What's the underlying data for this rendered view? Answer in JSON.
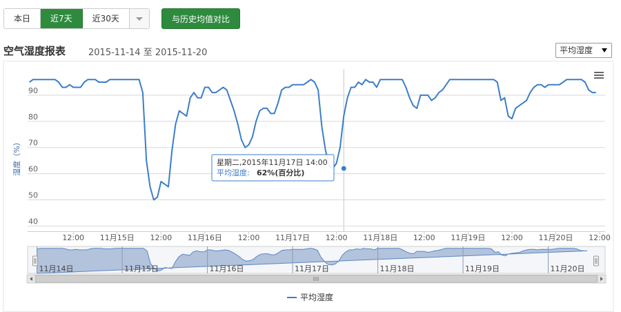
{
  "toolbar": {
    "range_buttons": [
      {
        "label": "本日",
        "active": false
      },
      {
        "label": "近7天",
        "active": true
      },
      {
        "label": "近30天",
        "active": false
      }
    ],
    "dropdown_icon": "caret-down-icon",
    "compare_label": "与历史均值对比"
  },
  "header": {
    "title": "空气湿度报表",
    "date_from": "2015-11-14",
    "date_sep": "至",
    "date_to": "2015-11-20",
    "metric_select": "平均湿度"
  },
  "colors": {
    "accent_green": "#2e8b3e",
    "series_line": "#3b7dc8",
    "navigator_fill": "#b3c3dc",
    "axis_title": "#3e6ea8"
  },
  "menu_icon": "hamburger-menu-icon",
  "tooltip": {
    "line1": "星期二,2015年11月17日 14:00",
    "label": "平均湿度:",
    "value": "62%(百分比)"
  },
  "chart_data": {
    "type": "line",
    "ylabel": "湿度（%）",
    "ylim": [
      38,
      100
    ],
    "y_ticks": [
      40,
      50,
      60,
      70,
      80,
      90
    ],
    "grid": true,
    "x_ticks": [
      "12:00",
      "11月15日",
      "12:00",
      "11月16日",
      "12:00",
      "11月17日",
      "12:00",
      "11月18日",
      "12:00",
      "11月19日",
      "12:00",
      "11月20日",
      "12:00"
    ],
    "x_tick_hours": [
      12,
      24,
      36,
      48,
      60,
      72,
      84,
      96,
      108,
      120,
      132,
      144,
      156
    ],
    "navigator_labels": [
      "11月14日",
      "11月15日",
      "11月16日",
      "11月17日",
      "11月18日",
      "11月19日",
      "11月20日"
    ],
    "navigator_hours": [
      0,
      24,
      48,
      72,
      96,
      120,
      144
    ],
    "legend": "top-center",
    "series": [
      {
        "name": "平均湿度",
        "x_hours": [
          0,
          1,
          2,
          3,
          4,
          5,
          6,
          7,
          8,
          9,
          10,
          11,
          12,
          13,
          14,
          15,
          16,
          17,
          18,
          19,
          20,
          21,
          22,
          23,
          24,
          25,
          26,
          27,
          28,
          29,
          30,
          31,
          32,
          33,
          34,
          35,
          36,
          37,
          38,
          39,
          40,
          41,
          42,
          43,
          44,
          45,
          46,
          47,
          48,
          49,
          50,
          51,
          52,
          53,
          54,
          55,
          56,
          57,
          58,
          59,
          60,
          61,
          62,
          63,
          64,
          65,
          66,
          67,
          68,
          69,
          70,
          71,
          72,
          73,
          74,
          75,
          76,
          77,
          78,
          79,
          80,
          81,
          82,
          83,
          84,
          85,
          86,
          87,
          88,
          89,
          90,
          91,
          92,
          93,
          94,
          95,
          96,
          97,
          98,
          99,
          100,
          101,
          102,
          103,
          104,
          105,
          106,
          107,
          108,
          109,
          110,
          111,
          112,
          113,
          114,
          115,
          116,
          117,
          118,
          119,
          120,
          121,
          122,
          123,
          124,
          125,
          126,
          127,
          128,
          129,
          130,
          131,
          132,
          133,
          134,
          135,
          136,
          137,
          138,
          139,
          140,
          141,
          142,
          143,
          144,
          145,
          146,
          147,
          148,
          149,
          150,
          151,
          152,
          153,
          154,
          155,
          156,
          157
        ],
        "values": [
          95,
          96,
          96,
          96,
          96,
          96,
          96,
          96,
          95,
          93,
          93,
          94,
          93,
          93,
          93,
          95,
          96,
          96,
          96,
          95,
          95,
          95,
          96,
          96,
          96,
          96,
          96,
          96,
          96,
          96,
          96,
          91,
          65,
          55,
          50,
          51,
          57,
          56,
          55,
          69,
          79,
          84,
          83,
          82,
          89,
          91,
          89,
          89,
          93,
          93,
          91,
          91,
          92,
          93,
          92,
          88,
          84,
          79,
          73,
          70,
          71,
          74,
          80,
          84,
          85,
          85,
          83,
          83,
          87,
          92,
          93,
          93,
          94,
          94,
          94,
          94,
          95,
          96,
          95,
          92,
          78,
          69,
          63,
          62,
          64,
          70,
          82,
          89,
          93,
          93,
          95,
          94,
          96,
          95,
          95,
          93,
          96,
          96,
          96,
          96,
          96,
          96,
          96,
          93,
          89,
          86,
          85,
          90,
          90,
          90,
          88,
          89,
          91,
          92,
          94,
          96,
          96,
          96,
          96,
          96,
          96,
          96,
          96,
          96,
          96,
          96,
          96,
          96,
          95,
          88,
          89,
          82,
          81,
          85,
          86,
          87,
          88,
          91,
          93,
          94,
          94,
          93,
          94,
          94,
          94,
          94,
          95,
          96,
          96,
          96,
          96,
          96,
          95,
          92,
          91,
          91
        ]
      }
    ],
    "highlight": {
      "x_hour": 86,
      "value": 62
    }
  }
}
